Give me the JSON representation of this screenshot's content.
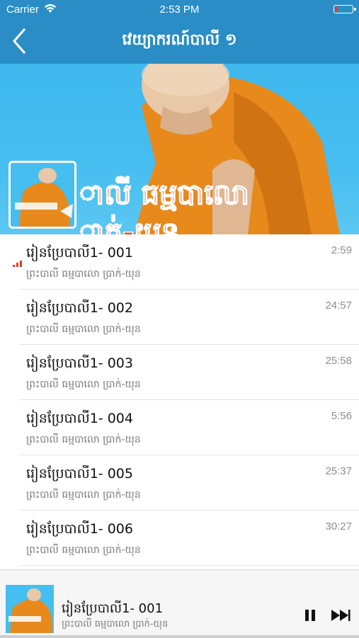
{
  "status_bar": {
    "carrier": "Carrier",
    "time": "2:53 PM",
    "wifi_icon": "wifi-icon",
    "battery_icon": "battery-low-icon",
    "battery_level": 0.15
  },
  "nav": {
    "back_icon": "chevron-left-icon",
    "title": "វេយ្យាករណ៍បាលី ១"
  },
  "hero": {
    "banner_text_line1": "ាលី ធម្មបាលោ",
    "banner_text_line2": "ាក់-យុន",
    "colors": {
      "sky": "#46bef0",
      "robe": "#e8891c",
      "banner_text": "#e2492b"
    }
  },
  "tracks": [
    {
      "title": "រៀនប្រែបាលី1- 001",
      "subtitle": "ព្រះបាលី ធម្មបាលោ ប្រាក់-យុន",
      "duration": "2:59",
      "playing": true
    },
    {
      "title": "រៀនប្រែបាលី1- 002",
      "subtitle": "ព្រះបាលី ធម្មបាលោ ប្រាក់-យុន",
      "duration": "24:57",
      "playing": false
    },
    {
      "title": "រៀនប្រែបាលី1- 003",
      "subtitle": "ព្រះបាលី ធម្មបាលោ ប្រាក់-យុន",
      "duration": "25:58",
      "playing": false
    },
    {
      "title": "រៀនប្រែបាលី1- 004",
      "subtitle": "ព្រះបាលី ធម្មបាលោ ប្រាក់-យុន",
      "duration": "5:56",
      "playing": false
    },
    {
      "title": "រៀនប្រែបាលី1- 005",
      "subtitle": "ព្រះបាលី ធម្មបាលោ ប្រាក់-យុន",
      "duration": "25:37",
      "playing": false
    },
    {
      "title": "រៀនប្រែបាលី1- 006",
      "subtitle": "ព្រះបាលី ធម្មបាលោ ប្រាក់-យុន",
      "duration": "30:27",
      "playing": false
    }
  ],
  "player": {
    "title": "រៀនប្រែបាលី1- 001",
    "subtitle": "ព្រះបាលី ធម្មបាលោ ប្រាក់-យុន",
    "pause_icon": "pause-icon",
    "next_icon": "fast-forward-icon"
  },
  "colors": {
    "accent": "#2a8dc5",
    "playing_indicator": "#e53b2c",
    "text_primary": "#111111",
    "text_secondary": "#7a7a7a"
  }
}
